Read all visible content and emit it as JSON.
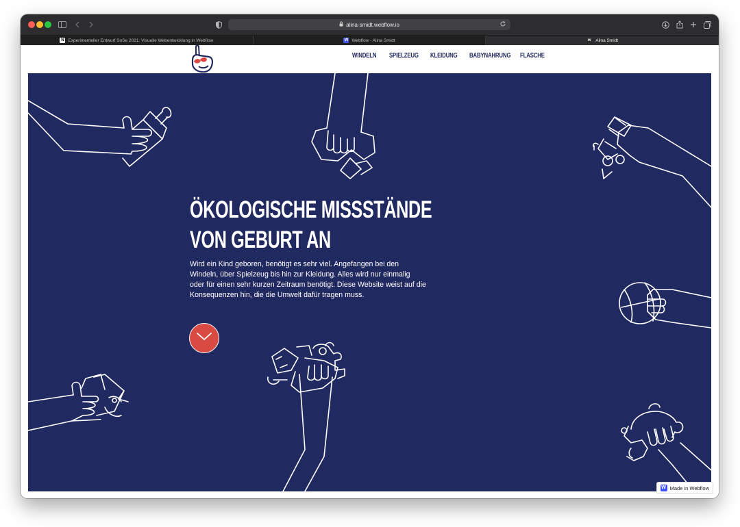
{
  "browser": {
    "url": "alina-smidt.webflow.io",
    "tabs": [
      {
        "label": "Experimenteller Entwurf SoSe 2021: Visuelle Webentwicklung in Webflow",
        "favicon": "notion-icon",
        "active": false
      },
      {
        "label": "Webflow - Alina Smidt",
        "favicon": "webflow-icon",
        "active": false
      },
      {
        "label": "Alina Smidt",
        "favicon": "webflow-w-icon",
        "active": true
      }
    ]
  },
  "site": {
    "logo": "pointing-hand-logo",
    "nav": [
      "WINDELN",
      "SPIELZEUG",
      "KLEIDUNG",
      "BABYNAHRUNG",
      "FLASCHE"
    ]
  },
  "hero": {
    "headline_line1": "ÖKOLOGISCHE MISSSTÄNDE",
    "headline_line2": "VON GEBURT AN",
    "intro": "Wird ein Kind geboren, benötigt es sehr viel. Angefangen bei den Windeln, über Spielzeug bis hin zur Kleidung. Alles wird nur einmalig oder für einen sehr kurzen Zeitraum benötigt. Diese Website weist auf die Konsequenzen hin, die die Umwelt dafür tragen muss.",
    "scroll_icon": "chevron-down-icon"
  },
  "badge": {
    "label": "Made in Webflow"
  },
  "colors": {
    "hero_bg": "#202960",
    "accent": "#d94a43",
    "nav_text": "#222a5d"
  }
}
